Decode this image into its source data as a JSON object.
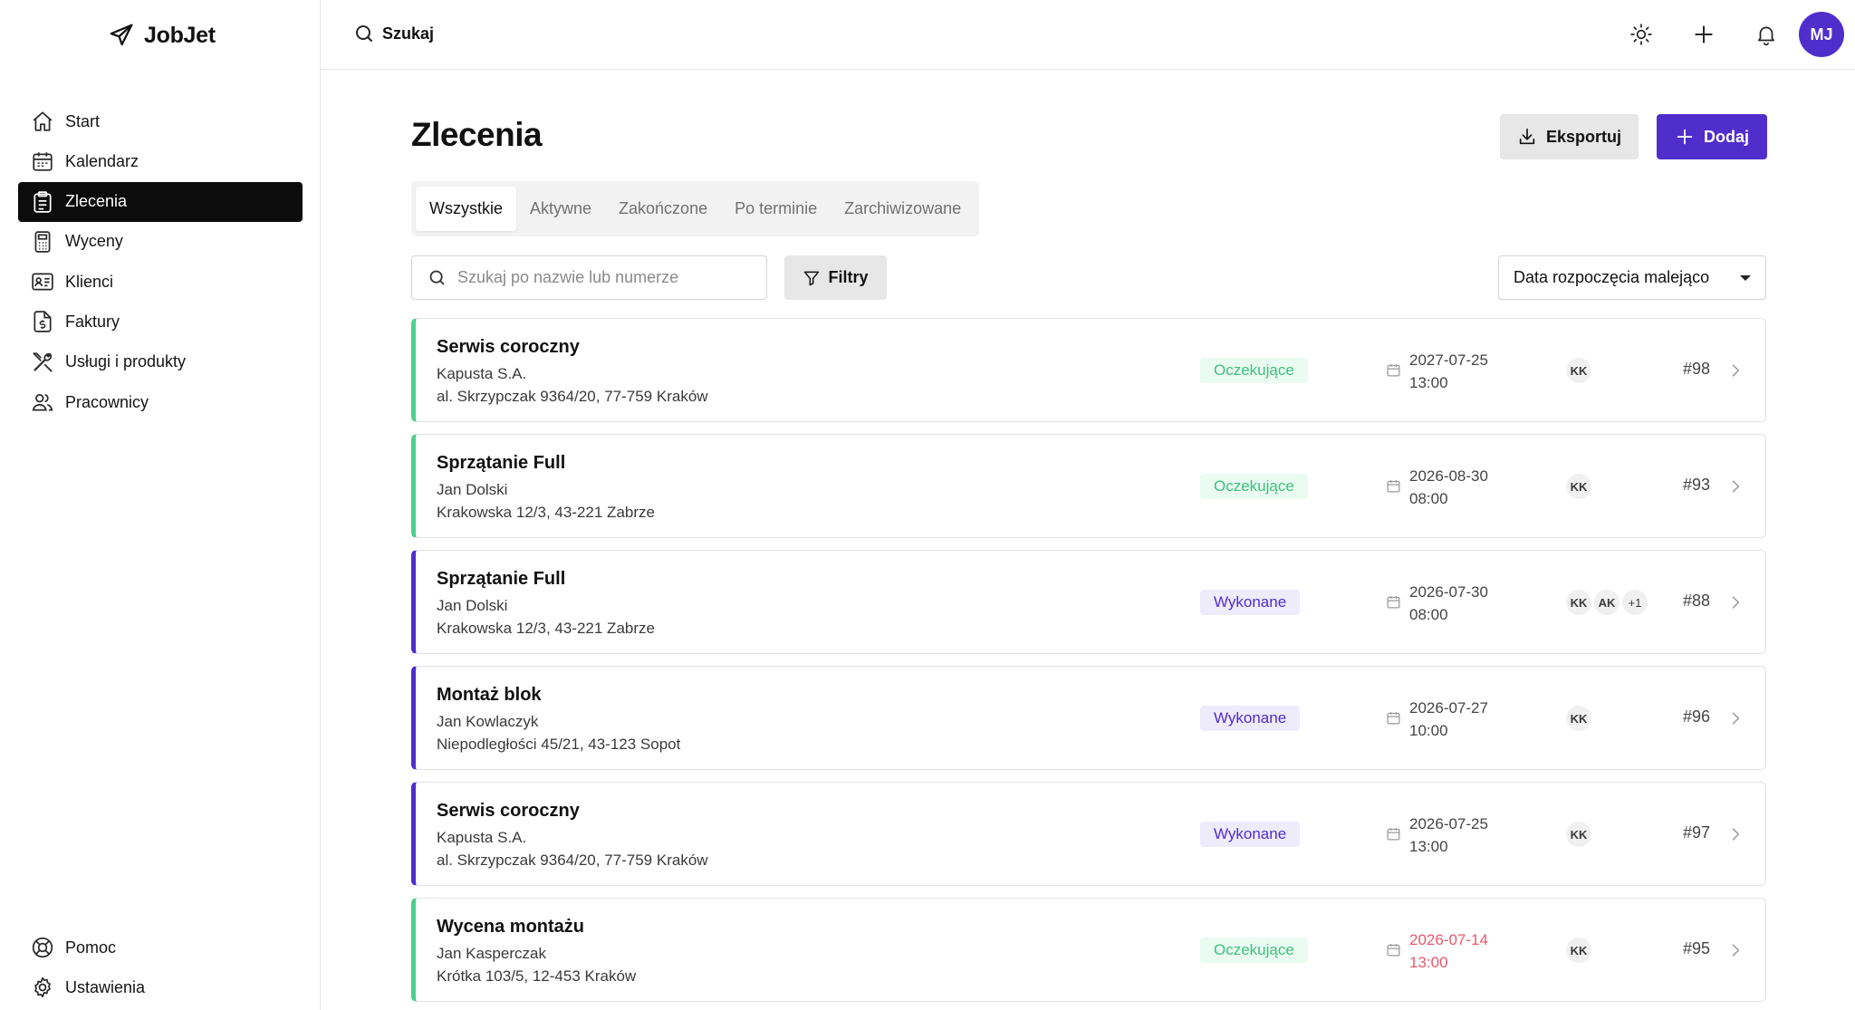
{
  "app": {
    "name": "JobJet"
  },
  "sidebar": {
    "items": [
      {
        "label": "Start",
        "icon": "home-icon"
      },
      {
        "label": "Kalendarz",
        "icon": "calendar-icon"
      },
      {
        "label": "Zlecenia",
        "icon": "clipboard-icon",
        "active": true
      },
      {
        "label": "Wyceny",
        "icon": "calculator-icon"
      },
      {
        "label": "Klienci",
        "icon": "contact-card-icon"
      },
      {
        "label": "Faktury",
        "icon": "invoice-icon"
      },
      {
        "label": "Usługi i produkty",
        "icon": "tools-icon"
      },
      {
        "label": "Pracownicy",
        "icon": "users-icon"
      }
    ],
    "bottom": [
      {
        "label": "Pomoc",
        "icon": "lifebuoy-icon"
      },
      {
        "label": "Ustawienia",
        "icon": "gear-icon"
      }
    ]
  },
  "topbar": {
    "search_label": "Szukaj",
    "user_initials": "MJ"
  },
  "main": {
    "title": "Zlecenia",
    "export_label": "Eksportuj",
    "add_label": "Dodaj",
    "tabs": [
      {
        "label": "Wszystkie",
        "active": true
      },
      {
        "label": "Aktywne"
      },
      {
        "label": "Zakończone"
      },
      {
        "label": "Po terminie"
      },
      {
        "label": "Zarchiwizowane"
      }
    ],
    "search_placeholder": "Szukaj po nazwie lub numerze",
    "filters_label": "Filtry",
    "sort_value": "Data rozpoczęcia malejąco"
  },
  "orders": [
    {
      "title": "Serwis coroczny",
      "client": "Kapusta S.A.",
      "address": "al. Skrzypczak 9364/20, 77-759 Kraków",
      "status": "Oczekujące",
      "date": "2027-07-25",
      "time": "13:00",
      "assignees": [
        "KK"
      ],
      "number": "#98"
    },
    {
      "title": "Sprzątanie Full",
      "client": "Jan Dolski",
      "address": "Krakowska 12/3, 43-221 Zabrze",
      "status": "Oczekujące",
      "date": "2026-08-30",
      "time": "08:00",
      "assignees": [
        "KK"
      ],
      "number": "#93"
    },
    {
      "title": "Sprzątanie Full",
      "client": "Jan Dolski",
      "address": "Krakowska 12/3, 43-221 Zabrze",
      "status": "Wykonane",
      "date": "2026-07-30",
      "time": "08:00",
      "assignees": [
        "KK",
        "AK"
      ],
      "more": "+1",
      "number": "#88"
    },
    {
      "title": "Montaż blok",
      "client": "Jan Kowlaczyk",
      "address": "Niepodległości 45/21, 43-123 Sopot",
      "status": "Wykonane",
      "date": "2026-07-27",
      "time": "10:00",
      "assignees": [
        "KK"
      ],
      "number": "#96"
    },
    {
      "title": "Serwis coroczny",
      "client": "Kapusta S.A.",
      "address": "al. Skrzypczak 9364/20, 77-759 Kraków",
      "status": "Wykonane",
      "date": "2026-07-25",
      "time": "13:00",
      "assignees": [
        "KK"
      ],
      "number": "#97"
    },
    {
      "title": "Wycena montażu",
      "client": "Jan Kasperczak",
      "address": "Krótka 103/5, 12-453 Kraków",
      "status": "Oczekujące",
      "date": "2026-07-14",
      "time": "13:00",
      "overdue": true,
      "assignees": [
        "KK"
      ],
      "number": "#95"
    }
  ],
  "colors": {
    "accent": "#4f2ecb",
    "pending": "#4ccf8f",
    "overdue": "#e5586b"
  }
}
